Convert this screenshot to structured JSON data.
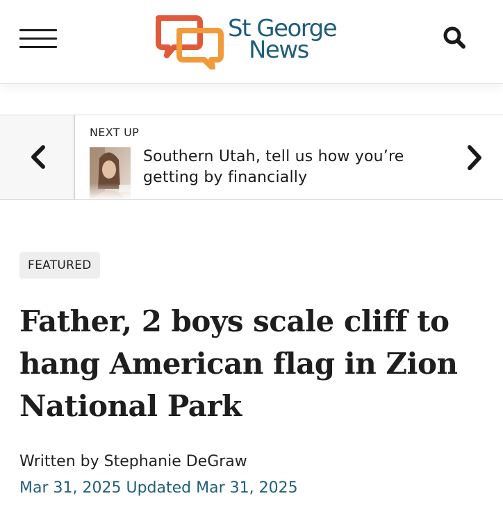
{
  "header": {
    "logo_line1": "St George",
    "logo_line2": "News",
    "menu_icon": "hamburger-menu-icon",
    "search_icon": "search-icon",
    "colors": {
      "brand_text": "#1f5e7a",
      "logo_red": "#e05a3a",
      "logo_orange": "#f29a3a"
    }
  },
  "next_up": {
    "label": "NEXT UP",
    "title": "Southern Utah, tell us how you’re getting by financially",
    "prev_icon": "chevron-left-icon",
    "next_icon": "chevron-right-icon"
  },
  "article": {
    "category": "FEATURED",
    "headline": "Father, 2 boys scale cliff to hang American flag in Zion National Park",
    "byline_prefix": "Written by",
    "author": "Stephanie DeGraw",
    "published": "Mar 31, 2025",
    "updated_label": "Updated",
    "updated": "Mar 31, 2025"
  }
}
